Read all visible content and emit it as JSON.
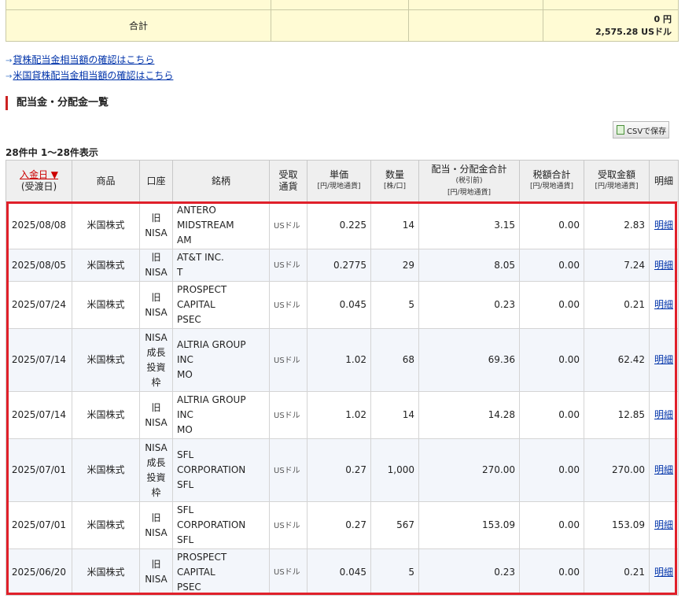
{
  "summary": {
    "label": "合計",
    "total_jpy": "0 円",
    "total_usd": "2,575.28 USドル"
  },
  "links": [
    {
      "label": "貸株配当金相当額の確認はこちら"
    },
    {
      "label": "米国貸株配当金相当額の確認はこちら"
    }
  ],
  "section_title": "配当金・分配金一覧",
  "csv_button": "CSVで保存",
  "count_text": "28件中 1～28件表示",
  "table": {
    "headers": {
      "date_main": "入金日 ▼",
      "date_sub": "(受渡日)",
      "product": "商品",
      "account": "口座",
      "issue": "銘柄",
      "currency_1": "受取",
      "currency_2": "通貨",
      "unit_price": "単価",
      "unit_price_sub": "[円/現地通貨]",
      "quantity": "数量",
      "quantity_sub": "[株/口]",
      "total": "配当・分配金合計",
      "total_sub1": "(税引前)",
      "total_sub2": "[円/現地通貨]",
      "tax": "税額合計",
      "tax_sub": "[円/現地通貨]",
      "received": "受取金額",
      "received_sub": "[円/現地通貨]",
      "detail": "明細"
    },
    "rows": [
      {
        "date": "2025/08/08",
        "product": "米国株式",
        "account": [
          "旧",
          "NISA"
        ],
        "issue": [
          "ANTERO",
          "MIDSTREAM",
          "AM"
        ],
        "currency": "USドル",
        "unit_price": "0.225",
        "quantity": "14",
        "total": "3.15",
        "tax": "0.00",
        "received": "2.83",
        "detail": "明細"
      },
      {
        "date": "2025/08/05",
        "product": "米国株式",
        "account": [
          "旧",
          "NISA"
        ],
        "issue": [
          "AT&T INC.",
          "T"
        ],
        "currency": "USドル",
        "unit_price": "0.2775",
        "quantity": "29",
        "total": "8.05",
        "tax": "0.00",
        "received": "7.24",
        "detail": "明細"
      },
      {
        "date": "2025/07/24",
        "product": "米国株式",
        "account": [
          "旧",
          "NISA"
        ],
        "issue": [
          "PROSPECT",
          "CAPITAL",
          "PSEC"
        ],
        "currency": "USドル",
        "unit_price": "0.045",
        "quantity": "5",
        "total": "0.23",
        "tax": "0.00",
        "received": "0.21",
        "detail": "明細"
      },
      {
        "date": "2025/07/14",
        "product": "米国株式",
        "account": [
          "NISA",
          "成長",
          "投資",
          "枠"
        ],
        "issue": [
          "ALTRIA GROUP",
          "INC",
          "MO"
        ],
        "currency": "USドル",
        "unit_price": "1.02",
        "quantity": "68",
        "total": "69.36",
        "tax": "0.00",
        "received": "62.42",
        "detail": "明細"
      },
      {
        "date": "2025/07/14",
        "product": "米国株式",
        "account": [
          "旧",
          "NISA"
        ],
        "issue": [
          "ALTRIA GROUP",
          "INC",
          "MO"
        ],
        "currency": "USドル",
        "unit_price": "1.02",
        "quantity": "14",
        "total": "14.28",
        "tax": "0.00",
        "received": "12.85",
        "detail": "明細"
      },
      {
        "date": "2025/07/01",
        "product": "米国株式",
        "account": [
          "NISA",
          "成長",
          "投資",
          "枠"
        ],
        "issue": [
          "SFL",
          "CORPORATION",
          "SFL"
        ],
        "currency": "USドル",
        "unit_price": "0.27",
        "quantity": "1,000",
        "total": "270.00",
        "tax": "0.00",
        "received": "270.00",
        "detail": "明細"
      },
      {
        "date": "2025/07/01",
        "product": "米国株式",
        "account": [
          "旧",
          "NISA"
        ],
        "issue": [
          "SFL",
          "CORPORATION",
          "SFL"
        ],
        "currency": "USドル",
        "unit_price": "0.27",
        "quantity": "567",
        "total": "153.09",
        "tax": "0.00",
        "received": "153.09",
        "detail": "明細"
      },
      {
        "date": "2025/06/20",
        "product": "米国株式",
        "account": [
          "旧",
          "NISA"
        ],
        "issue": [
          "PROSPECT",
          "CAPITAL",
          "PSEC"
        ],
        "currency": "USドル",
        "unit_price": "0.045",
        "quantity": "5",
        "total": "0.23",
        "tax": "0.00",
        "received": "0.21",
        "detail": "明細"
      }
    ]
  },
  "colors": {
    "highlight_border": "#e0202a",
    "summary_bg": "#fffbd4",
    "link": "#0033aa"
  }
}
